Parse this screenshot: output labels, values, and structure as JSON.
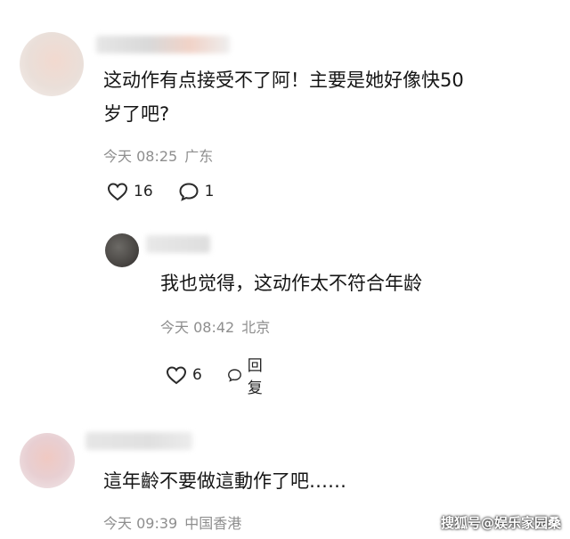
{
  "comments": [
    {
      "text_line1": "这动作有点接受不了阿！主要是她好像快50",
      "text_line2": "岁了吧?",
      "time": "今天 08:25",
      "location": "广东",
      "likes": "16",
      "replies": "1"
    },
    {
      "text_line1": "我也觉得，这动作太不符合年龄",
      "time": "今天 08:42",
      "location": "北京",
      "likes": "6",
      "reply_label": "回复"
    },
    {
      "text_line1": "這年齡不要做這動作了吧……",
      "time": "今天 09:39",
      "location": "中国香港"
    }
  ],
  "watermark": "搜狐号@娱乐家园桑",
  "icons": {
    "like": "heart-outline-icon",
    "comment": "speech-bubble-icon"
  }
}
